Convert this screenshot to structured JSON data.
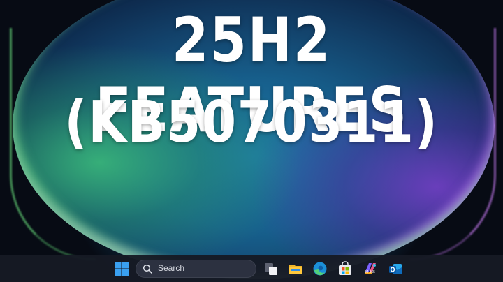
{
  "headline": {
    "line1": "25H2 FEATURES",
    "line2": "(KB5070311)"
  },
  "taskbar": {
    "search_label": "Search",
    "m365_label": "M 365",
    "icons": [
      "windows-start-icon",
      "search-icon",
      "task-view-icon",
      "file-explorer-icon",
      "edge-browser-icon",
      "microsoft-store-icon",
      "microsoft-365-icon",
      "outlook-icon"
    ]
  },
  "colors": {
    "headline_text": "#ffffff",
    "taskbar_bg": "#161a24",
    "search_bg": "#2c3140",
    "bloom_green": "#3cbe78",
    "bloom_blue": "#1e79a6",
    "bloom_purple": "#783cc8",
    "windows_blue": "#3aa0f0"
  }
}
